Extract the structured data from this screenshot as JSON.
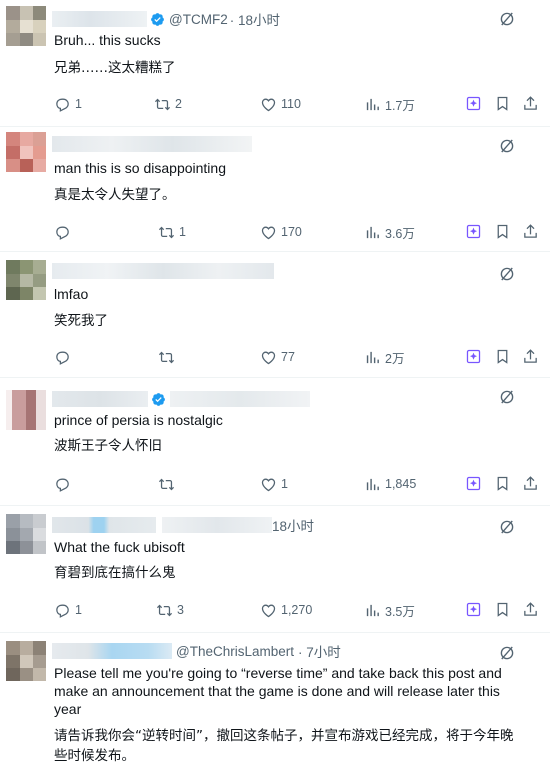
{
  "posts": [
    {
      "handle": "@TCMF2",
      "time": "· 18小时",
      "text_en": "Bruh... this sucks",
      "text_cn": "兄弟……这太糟糕了",
      "verified": true,
      "replies": "1",
      "reposts": "2",
      "likes": "110",
      "views": "1.7万"
    },
    {
      "handle": "",
      "time": "",
      "text_en": "man this is so disappointing",
      "text_cn": "真是太令人失望了。",
      "verified": false,
      "replies": "",
      "reposts": "1",
      "likes": "170",
      "views": "3.6万"
    },
    {
      "handle": "",
      "time": "",
      "text_en": "lmfao",
      "text_cn": "笑死我了",
      "verified": false,
      "replies": "",
      "reposts": "",
      "likes": "77",
      "views": "2万"
    },
    {
      "handle": "",
      "time": "",
      "text_en": "prince of persia is nostalgic",
      "text_cn": "波斯王子令人怀旧",
      "verified": true,
      "replies": "",
      "reposts": "",
      "likes": "1",
      "views": "1,845"
    },
    {
      "handle": "",
      "time": "18小时",
      "text_en": "What the fuck ubisoft",
      "text_cn": "育碧到底在搞什么鬼",
      "verified": false,
      "replies": "1",
      "reposts": "3",
      "likes": "1,270",
      "views": "3.5万"
    },
    {
      "handle": "@TheChrisLambert",
      "time": "· 7小时",
      "text_en": "Please tell me you're going to “reverse time” and take back this post and make an announcement that the game is done and will release later this year",
      "text_cn": "请告诉我你会“逆转时间”，撤回这条帖子，并宣布游戏已经完成，将于今年晚些时候发布。",
      "verified": false,
      "replies": "",
      "reposts": "",
      "likes": "",
      "views": ""
    }
  ],
  "colors": {
    "text": "#0f1419",
    "muted": "#536471",
    "verified": "#1d9bf0",
    "grok": "#7856ff",
    "divider": "#eff3f4"
  }
}
